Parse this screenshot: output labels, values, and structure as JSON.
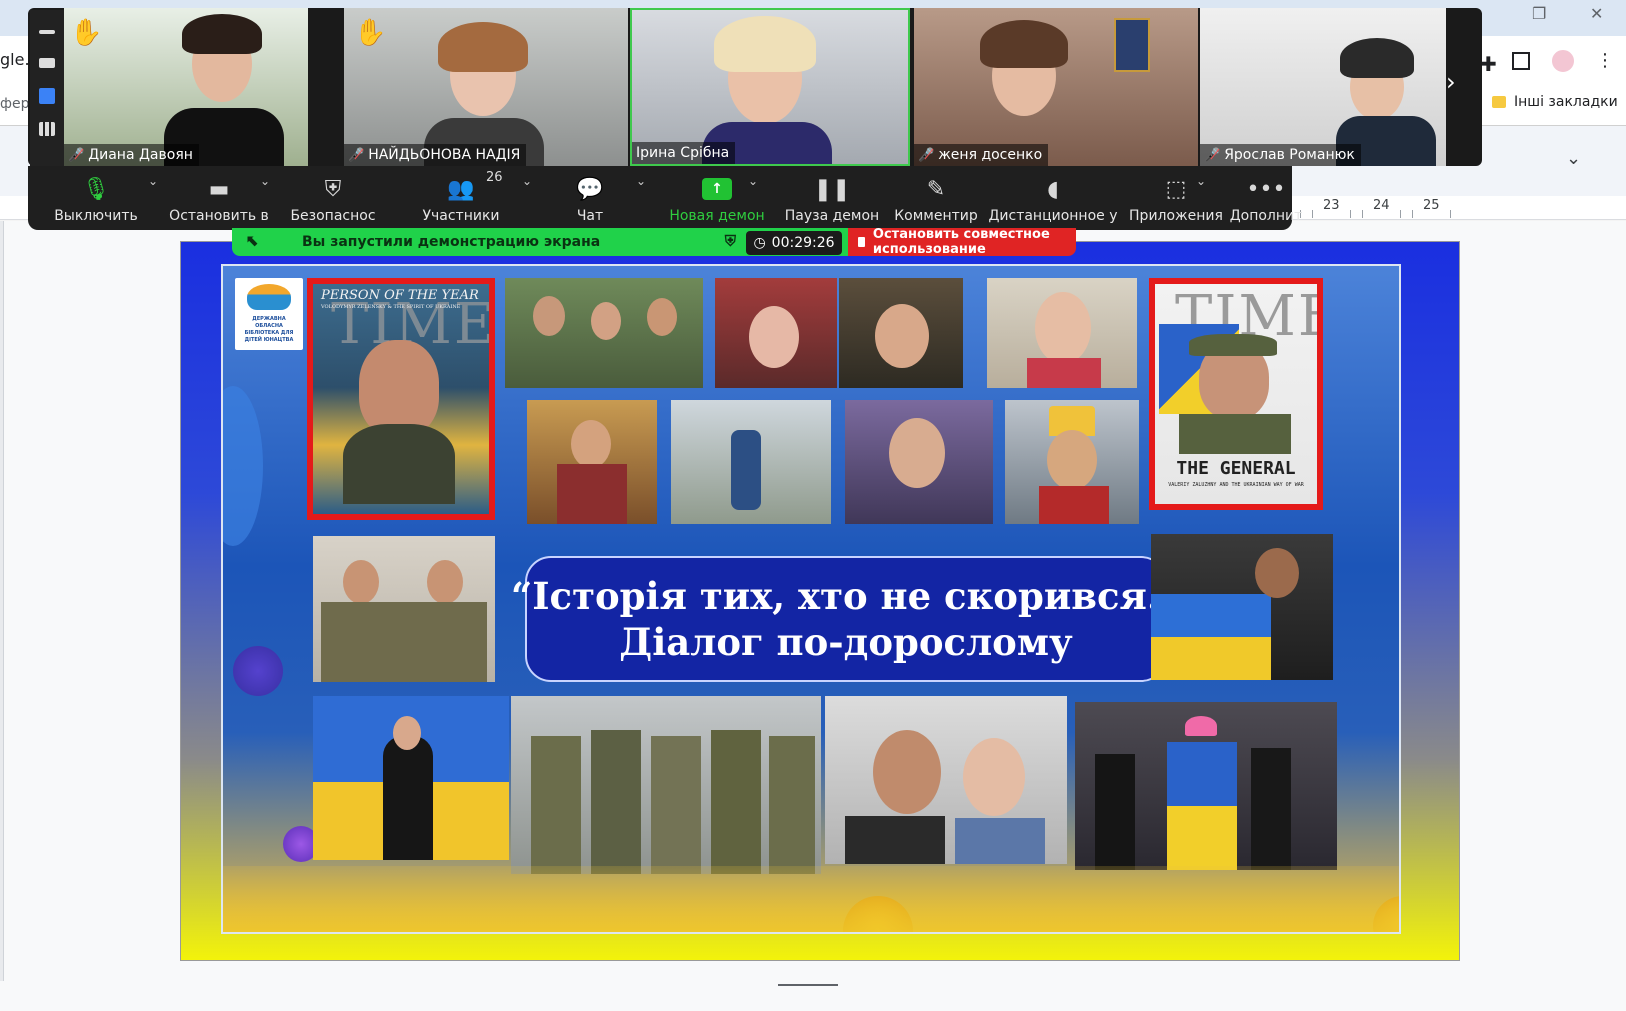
{
  "browser": {
    "address_fragment": "gle.",
    "address_fragment2": "фер",
    "bookmarks_label": "Інші закладки",
    "ruler_numbers": [
      "23",
      "24",
      "25"
    ]
  },
  "zoom": {
    "participants": [
      {
        "name": "Диана Давоян",
        "muted": true,
        "hand_raised": true
      },
      {
        "name": "НАЙДЬОНОВА НАДІЯ",
        "muted": true,
        "hand_raised": true
      },
      {
        "name": "Ірина Срібна",
        "muted": false,
        "hand_raised": false
      },
      {
        "name": "женя досенко",
        "muted": true,
        "hand_raised": false
      },
      {
        "name": "Ярослав Романюк",
        "muted": true,
        "hand_raised": false
      }
    ],
    "toolbar": {
      "mute_label": "Выключить",
      "stop_video_label": "Остановить в",
      "security_label": "Безопаснос",
      "participants_label": "Участники",
      "participants_count": "26",
      "chat_label": "Чат",
      "new_share_label": "Новая демон",
      "pause_share_label": "Пауза демон",
      "annotate_label": "Комментир",
      "remote_control_label": "Дистанционное у",
      "apps_label": "Приложения",
      "more_label": "Дополнит"
    },
    "share_banner": {
      "message": "Вы запустили демонстрацию экрана",
      "timer": "00:29:26",
      "stop_label": "Остановить совместное использование"
    },
    "accent_green": "#20d24a",
    "accent_red": "#e02424"
  },
  "slide": {
    "headline_line1": "“Історія тих, хто не скорився.”",
    "headline_line2": "Діалог по-дорослому",
    "time_cover_left": {
      "masthead": "TIME",
      "tagline": "PERSON OF THE YEAR",
      "subline": "VOLODYMYR ZELENSKY & THE SPIRIT OF UKRAINE"
    },
    "time_cover_right": {
      "masthead": "TIME",
      "headline": "THE GENERAL",
      "subline": "VALERIY ZALUZHNY AND THE UKRAINIAN WAY OF WAR"
    },
    "logo_text": "ДЕРЖАВНА ОБЛАСНА БІБЛІОТЕКА ДЛЯ ДІТЕЙ ЮНАЦТВА"
  }
}
